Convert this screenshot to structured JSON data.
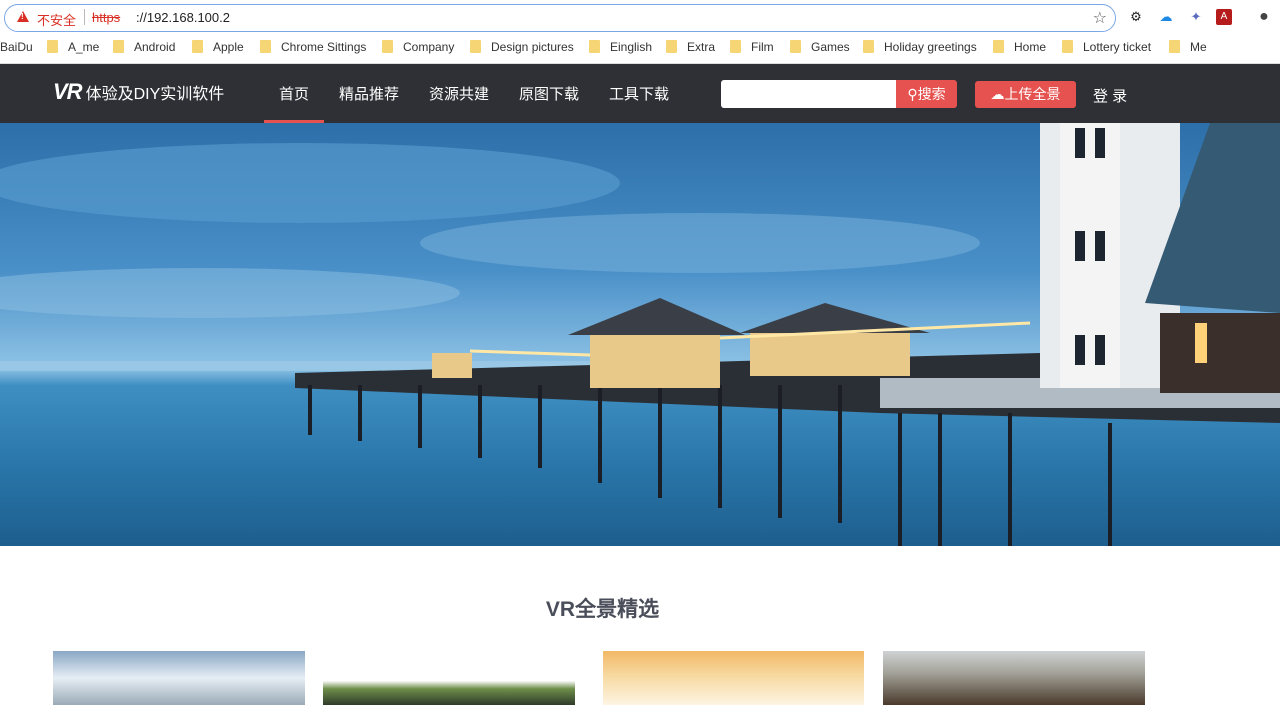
{
  "browser": {
    "security_label": "不安全",
    "url_scheme": "https",
    "url_rest": "://192.168.100.2",
    "bookmarks": [
      "BaiDu",
      "A_me",
      "Android",
      "Apple",
      "Chrome Sittings",
      "Company",
      "Design pictures",
      "Einglish",
      "Extra",
      "Film",
      "Games",
      "Holiday greetings",
      "Home",
      "Lottery ticket",
      "Me"
    ]
  },
  "site": {
    "logo_mark": "VR",
    "logo_text": "体验及DIY实训软件",
    "nav": [
      "首页",
      "精品推荐",
      "资源共建",
      "原图下载",
      "工具下载"
    ],
    "active_nav_index": 0,
    "search_placeholder": "",
    "search_button": "搜索",
    "upload_button": "上传全景",
    "login": "登 录",
    "accent_color": "#e5524f",
    "nav_bg_color": "#2e3035"
  },
  "section": {
    "title": "VR全景精选"
  }
}
